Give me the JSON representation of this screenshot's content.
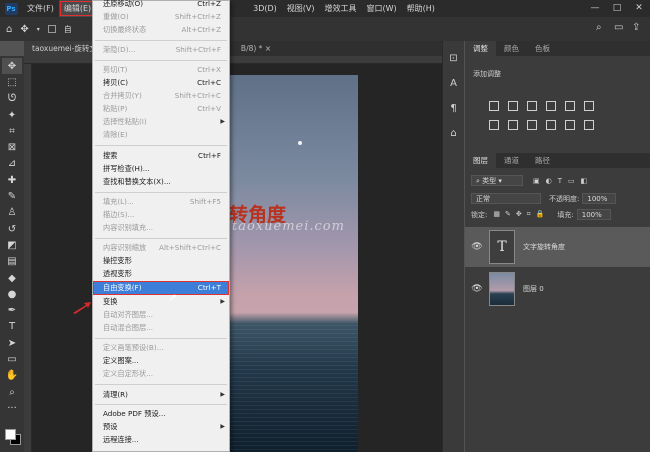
{
  "menubar": {
    "logo": "Ps",
    "items": [
      "文件(F)",
      "编辑(E)",
      "",
      "",
      "",
      "",
      "",
      "3D(D)",
      "视图(V)",
      "增效工具",
      "窗口(W)",
      "帮助(H)"
    ],
    "win_min": "—",
    "win_max": "□",
    "win_close": "✕"
  },
  "optbar": {
    "auto_label": "自",
    "share_label": ""
  },
  "tabs": {
    "tab1": "taoxuemei-旋转文",
    "tab2": "B/8) *",
    "tab2_close": "×"
  },
  "canvas": {
    "title_text": "转角度",
    "watermark": "taoxuemei.com"
  },
  "menu": {
    "items": [
      {
        "label": "还原移动(O)",
        "shortcut": "Ctrl+Z",
        "disabled": false
      },
      {
        "label": "重做(O)",
        "shortcut": "Shift+Ctrl+Z",
        "disabled": true
      },
      {
        "label": "切换最终状态",
        "shortcut": "Alt+Ctrl+Z",
        "disabled": true
      },
      {
        "label": "渐隐(D)...",
        "shortcut": "Shift+Ctrl+F",
        "disabled": true
      },
      {
        "label": "剪切(T)",
        "shortcut": "Ctrl+X",
        "disabled": true
      },
      {
        "label": "拷贝(C)",
        "shortcut": "Ctrl+C",
        "disabled": false
      },
      {
        "label": "合并拷贝(Y)",
        "shortcut": "Shift+Ctrl+C",
        "disabled": true
      },
      {
        "label": "粘贴(P)",
        "shortcut": "Ctrl+V",
        "disabled": true
      },
      {
        "label": "选择性粘贴(I)",
        "shortcut": "",
        "disabled": true,
        "submenu": true
      },
      {
        "label": "清除(E)",
        "shortcut": "",
        "disabled": true
      },
      {
        "label": "搜索",
        "shortcut": "Ctrl+F",
        "disabled": false
      },
      {
        "label": "拼写检查(H)...",
        "shortcut": "",
        "disabled": false
      },
      {
        "label": "查找和替换文本(X)...",
        "shortcut": "",
        "disabled": false
      },
      {
        "label": "填充(L)...",
        "shortcut": "Shift+F5",
        "disabled": true
      },
      {
        "label": "描边(S)...",
        "shortcut": "",
        "disabled": true
      },
      {
        "label": "内容识别填充...",
        "shortcut": "",
        "disabled": true
      },
      {
        "label": "内容识别缩放",
        "shortcut": "Alt+Shift+Ctrl+C",
        "disabled": true
      },
      {
        "label": "操控变形",
        "shortcut": "",
        "disabled": false
      },
      {
        "label": "透视变形",
        "shortcut": "",
        "disabled": false
      },
      {
        "label": "自由变换(F)",
        "shortcut": "Ctrl+T",
        "disabled": false,
        "highlighted": true
      },
      {
        "label": "变换",
        "shortcut": "",
        "disabled": false,
        "submenu": true
      },
      {
        "label": "自动对齐图层...",
        "shortcut": "",
        "disabled": true
      },
      {
        "label": "自动混合图层...",
        "shortcut": "",
        "disabled": true
      },
      {
        "label": "定义画笔预设(B)...",
        "shortcut": "",
        "disabled": true
      },
      {
        "label": "定义图案...",
        "shortcut": "",
        "disabled": false
      },
      {
        "label": "定义自定形状...",
        "shortcut": "",
        "disabled": true
      },
      {
        "label": "清理(R)",
        "shortcut": "",
        "disabled": false,
        "submenu": true
      },
      {
        "label": "Adobe PDF 预设...",
        "shortcut": "",
        "disabled": false
      },
      {
        "label": "预设",
        "shortcut": "",
        "disabled": false,
        "submenu": true
      },
      {
        "label": "远程连接...",
        "shortcut": "",
        "disabled": false
      }
    ],
    "submenu_arrow": "▶"
  },
  "panels": {
    "tabs": [
      "调整",
      "颜色",
      "色板"
    ],
    "adjust_title": "添加调整",
    "layer_tabs": [
      "图层",
      "通道",
      "路径"
    ],
    "filter_label": "类型",
    "blend_mode": "正常",
    "opacity_label": "不透明度:",
    "opacity_value": "100%",
    "lock_label": "锁定:",
    "fill_label": "填充:",
    "fill_value": "100%",
    "layers": [
      {
        "name": "文字旋转角度",
        "thumb": "T"
      },
      {
        "name": "图层 0",
        "thumb": ""
      }
    ]
  }
}
